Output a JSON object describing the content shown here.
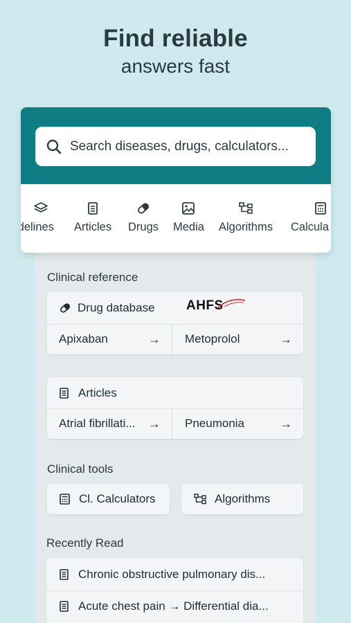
{
  "hero": {
    "title": "Find reliable",
    "subtitle": "answers fast"
  },
  "search": {
    "placeholder": "Search diseases, drugs, calculators..."
  },
  "tabs": [
    {
      "label": "idelines",
      "icon": "layers-icon"
    },
    {
      "label": "Articles",
      "icon": "document-icon"
    },
    {
      "label": "Drugs",
      "icon": "pill-icon"
    },
    {
      "label": "Media",
      "icon": "image-icon"
    },
    {
      "label": "Algorithms",
      "icon": "flowchart-icon"
    },
    {
      "label": "Calcula",
      "icon": "calculator-icon"
    }
  ],
  "clinical_reference": {
    "title": "Clinical reference",
    "drug_database": {
      "label": "Drug database",
      "logo": "AHFS",
      "items": [
        "Apixaban",
        "Metoprolol"
      ]
    },
    "articles": {
      "label": "Articles",
      "items": [
        "Atrial fibrillati...",
        "Pneumonia"
      ]
    }
  },
  "clinical_tools": {
    "title": "Clinical tools",
    "calculators": "Cl. Calculators",
    "algorithms": "Algorithms"
  },
  "recently_read": {
    "title": "Recently Read",
    "items": [
      "Chronic obstructive pulmonary dis...",
      "Acute chest pain → Differential dia..."
    ]
  },
  "arrow_glyph": "→",
  "colors": {
    "background": "#cfeaee",
    "header": "#0e7d84",
    "logo_accent": "#d9262c"
  }
}
